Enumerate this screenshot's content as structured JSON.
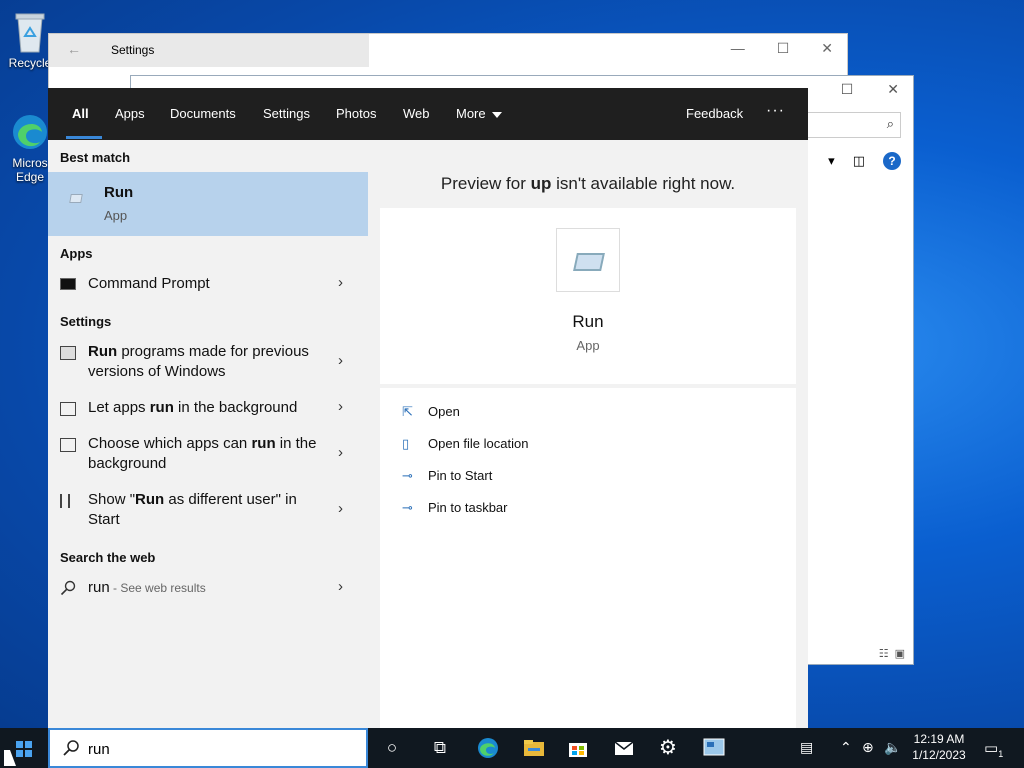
{
  "desktop": {
    "icons": [
      {
        "label": "Recycle"
      },
      {
        "label": "Micros Edge"
      }
    ]
  },
  "background_windows": {
    "settings": {
      "title": "Settings"
    }
  },
  "search": {
    "tabs": [
      {
        "label": "All"
      },
      {
        "label": "Apps"
      },
      {
        "label": "Documents"
      },
      {
        "label": "Settings"
      },
      {
        "label": "Photos"
      },
      {
        "label": "Web"
      },
      {
        "label": "More"
      }
    ],
    "feedback_label": "Feedback",
    "more_options": "···",
    "query": "run",
    "sections": {
      "best_match": "Best match",
      "apps": "Apps",
      "settings": "Settings",
      "web": "Search the web"
    },
    "best_match": {
      "title": "Run",
      "subtitle": "App"
    },
    "apps": [
      {
        "label": "Command Prompt"
      }
    ],
    "settings_results": [
      {
        "pre": "",
        "bold": "Run",
        "post": " programs made for previous versions of Windows"
      },
      {
        "pre": "Let apps ",
        "bold": "run",
        "post": " in the background"
      },
      {
        "pre": "Choose which apps can ",
        "bold": "run",
        "post": " in the background"
      },
      {
        "pre": "Show \"",
        "bold": "Run",
        "post": " as different user\" in Start"
      }
    ],
    "web_result": {
      "term": "run",
      "suffix": " - See web results"
    },
    "preview": {
      "header_pre": "Preview for ",
      "header_bold": "up",
      "header_post": " isn't available right now.",
      "title": "Run",
      "subtitle": "App",
      "actions": [
        {
          "label": "Open",
          "icon": "open-icon"
        },
        {
          "label": "Open file location",
          "icon": "file-location-icon"
        },
        {
          "label": "Pin to Start",
          "icon": "pin-icon"
        },
        {
          "label": "Pin to taskbar",
          "icon": "pin-icon"
        }
      ]
    }
  },
  "taskbar": {
    "clock_time": "12:19 AM",
    "clock_date": "1/12/2023",
    "notification_count": "1"
  },
  "colors": {
    "accent": "#3a88d8",
    "selection": "#b7d2ec",
    "search_header": "#1f1f1f",
    "taskbar": "#101820"
  }
}
